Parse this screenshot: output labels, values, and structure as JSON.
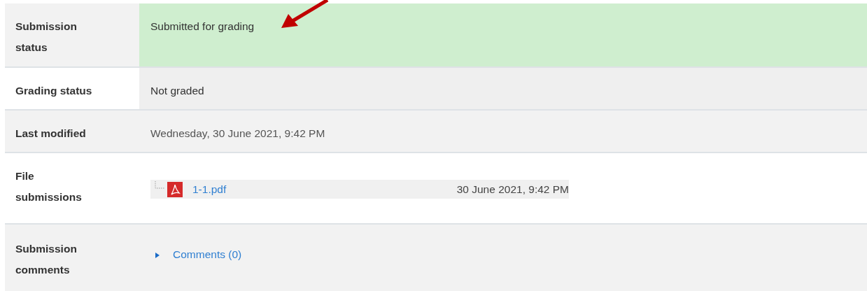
{
  "rows": [
    {
      "label": "Submission status",
      "kind": "status",
      "success": true,
      "value": "Submitted for grading"
    },
    {
      "label": "Grading status",
      "kind": "status",
      "success": false,
      "value": "Not graded"
    },
    {
      "label": "Last modified",
      "kind": "text",
      "value": "Wednesday, 30 June 2021, 9:42 PM"
    },
    {
      "label": "File submissions",
      "kind": "files",
      "files": [
        {
          "name": "1-1.pdf",
          "date": "30 June 2021, 9:42 PM"
        }
      ]
    },
    {
      "label": "Submission comments",
      "kind": "comments",
      "link": "Comments (0)",
      "expanded": false
    }
  ]
}
